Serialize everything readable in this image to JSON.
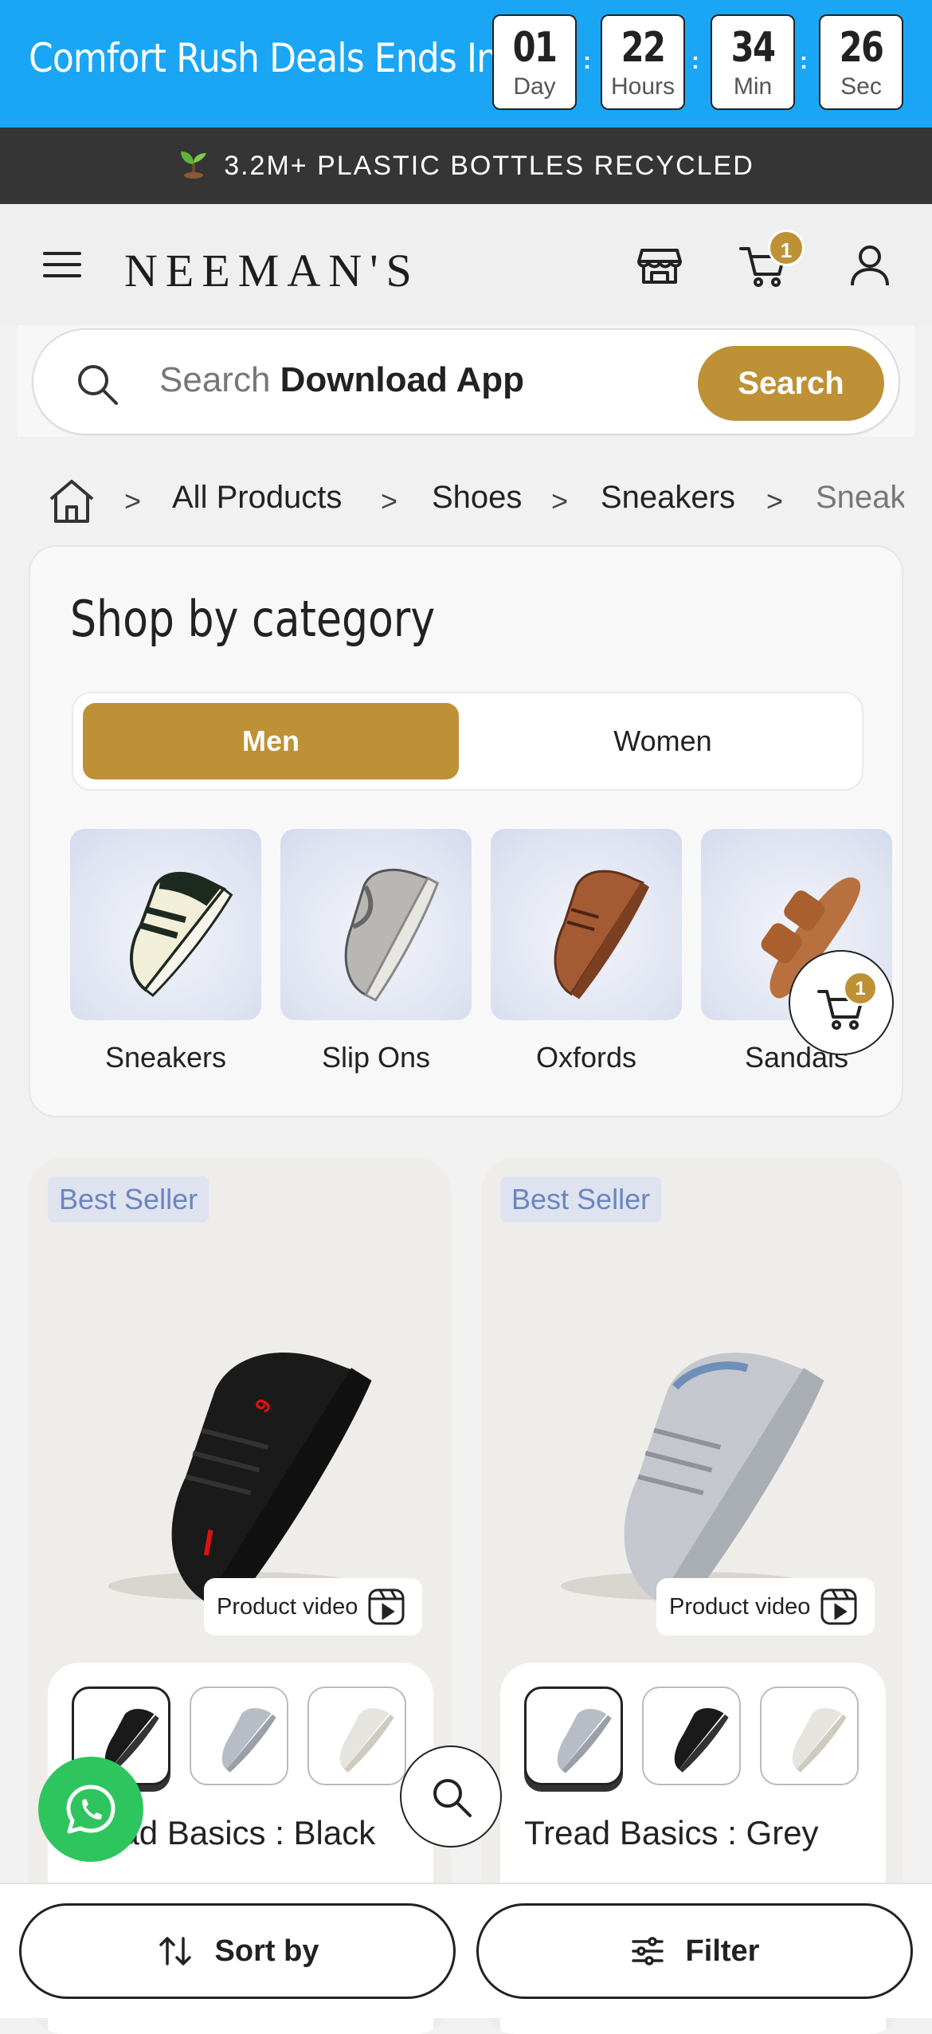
{
  "promo": {
    "title": "Comfort Rush Deals Ends In:",
    "countdown": [
      {
        "value": "01",
        "unit": "Day"
      },
      {
        "value": "22",
        "unit": "Hours"
      },
      {
        "value": "34",
        "unit": "Min"
      },
      {
        "value": "26",
        "unit": "Sec"
      }
    ],
    "separator": ":",
    "color": "#1aa6f5"
  },
  "eco": {
    "text": "3.2M+ PLASTIC BOTTLES RECYCLED",
    "icon": "sprout-icon"
  },
  "header": {
    "brand": "NEEMAN'S",
    "cart_count": "1",
    "icons": [
      "menu-icon",
      "store-icon",
      "cart-icon",
      "user-icon"
    ]
  },
  "search": {
    "placeholder": "Search",
    "suggestion": "Download App",
    "button_label": "Search"
  },
  "breadcrumb": {
    "items": [
      "All Products",
      "Shoes",
      "Sneakers",
      "Sneakers"
    ],
    "separator": ">"
  },
  "category": {
    "title": "Shop by category",
    "tabs": [
      {
        "label": "Men",
        "selected": true
      },
      {
        "label": "Women",
        "selected": false
      }
    ],
    "items": [
      {
        "label": "Sneakers"
      },
      {
        "label": "Slip Ons"
      },
      {
        "label": "Oxfords"
      },
      {
        "label": "Sandals"
      }
    ]
  },
  "floating_cart": {
    "count": "1"
  },
  "products": [
    {
      "badge": "Best Seller",
      "video_label": "Product video",
      "name": "Tread Basics : Black",
      "swatches": [
        "black",
        "grey",
        "white"
      ],
      "selected_swatch": 0
    },
    {
      "badge": "Best Seller",
      "video_label": "Product video",
      "name": "Tread Basics : Grey",
      "swatches": [
        "grey",
        "black",
        "white"
      ],
      "selected_swatch": 0
    }
  ],
  "bottom_bar": {
    "sort_label": "Sort by",
    "filter_label": "Filter"
  },
  "colors": {
    "accent": "#bf9136",
    "dark": "#353535",
    "badge_text": "#6a86c0",
    "whatsapp": "#2fc55e"
  }
}
